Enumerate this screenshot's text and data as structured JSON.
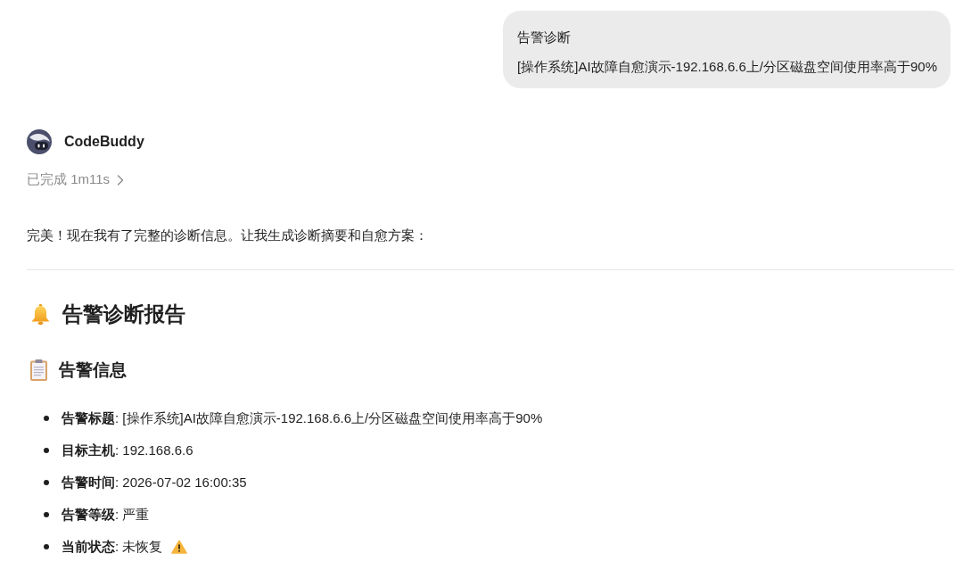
{
  "user_message": {
    "lines": [
      "告警诊断",
      "[操作系统]AI故障自愈演示-192.168.6.6上/分区磁盘空间使用率高于90%"
    ]
  },
  "assistant": {
    "name": "CodeBuddy",
    "status": {
      "label": "已完成 1m11s",
      "expanded": false
    },
    "intro": "完美！现在我有了完整的诊断信息。让我生成诊断摘要和自愈方案：",
    "report": {
      "title": "告警诊断报告",
      "section": {
        "title": "告警信息",
        "items": [
          {
            "text": "**告警标题**: [操作系统]AI故障自愈演示-192.168.6.6上/分区磁盘空间使用率高于90%",
            "warning": false
          },
          {
            "text": "**目标主机**: 192.168.6.6",
            "warning": false
          },
          {
            "text": "**告警时间**: 2026-07-02 16:00:35",
            "warning": false
          },
          {
            "text": "**告警等级**: 严重",
            "warning": false
          },
          {
            "text": "**当前状态**: 未恢复",
            "warning": true
          }
        ]
      }
    }
  }
}
